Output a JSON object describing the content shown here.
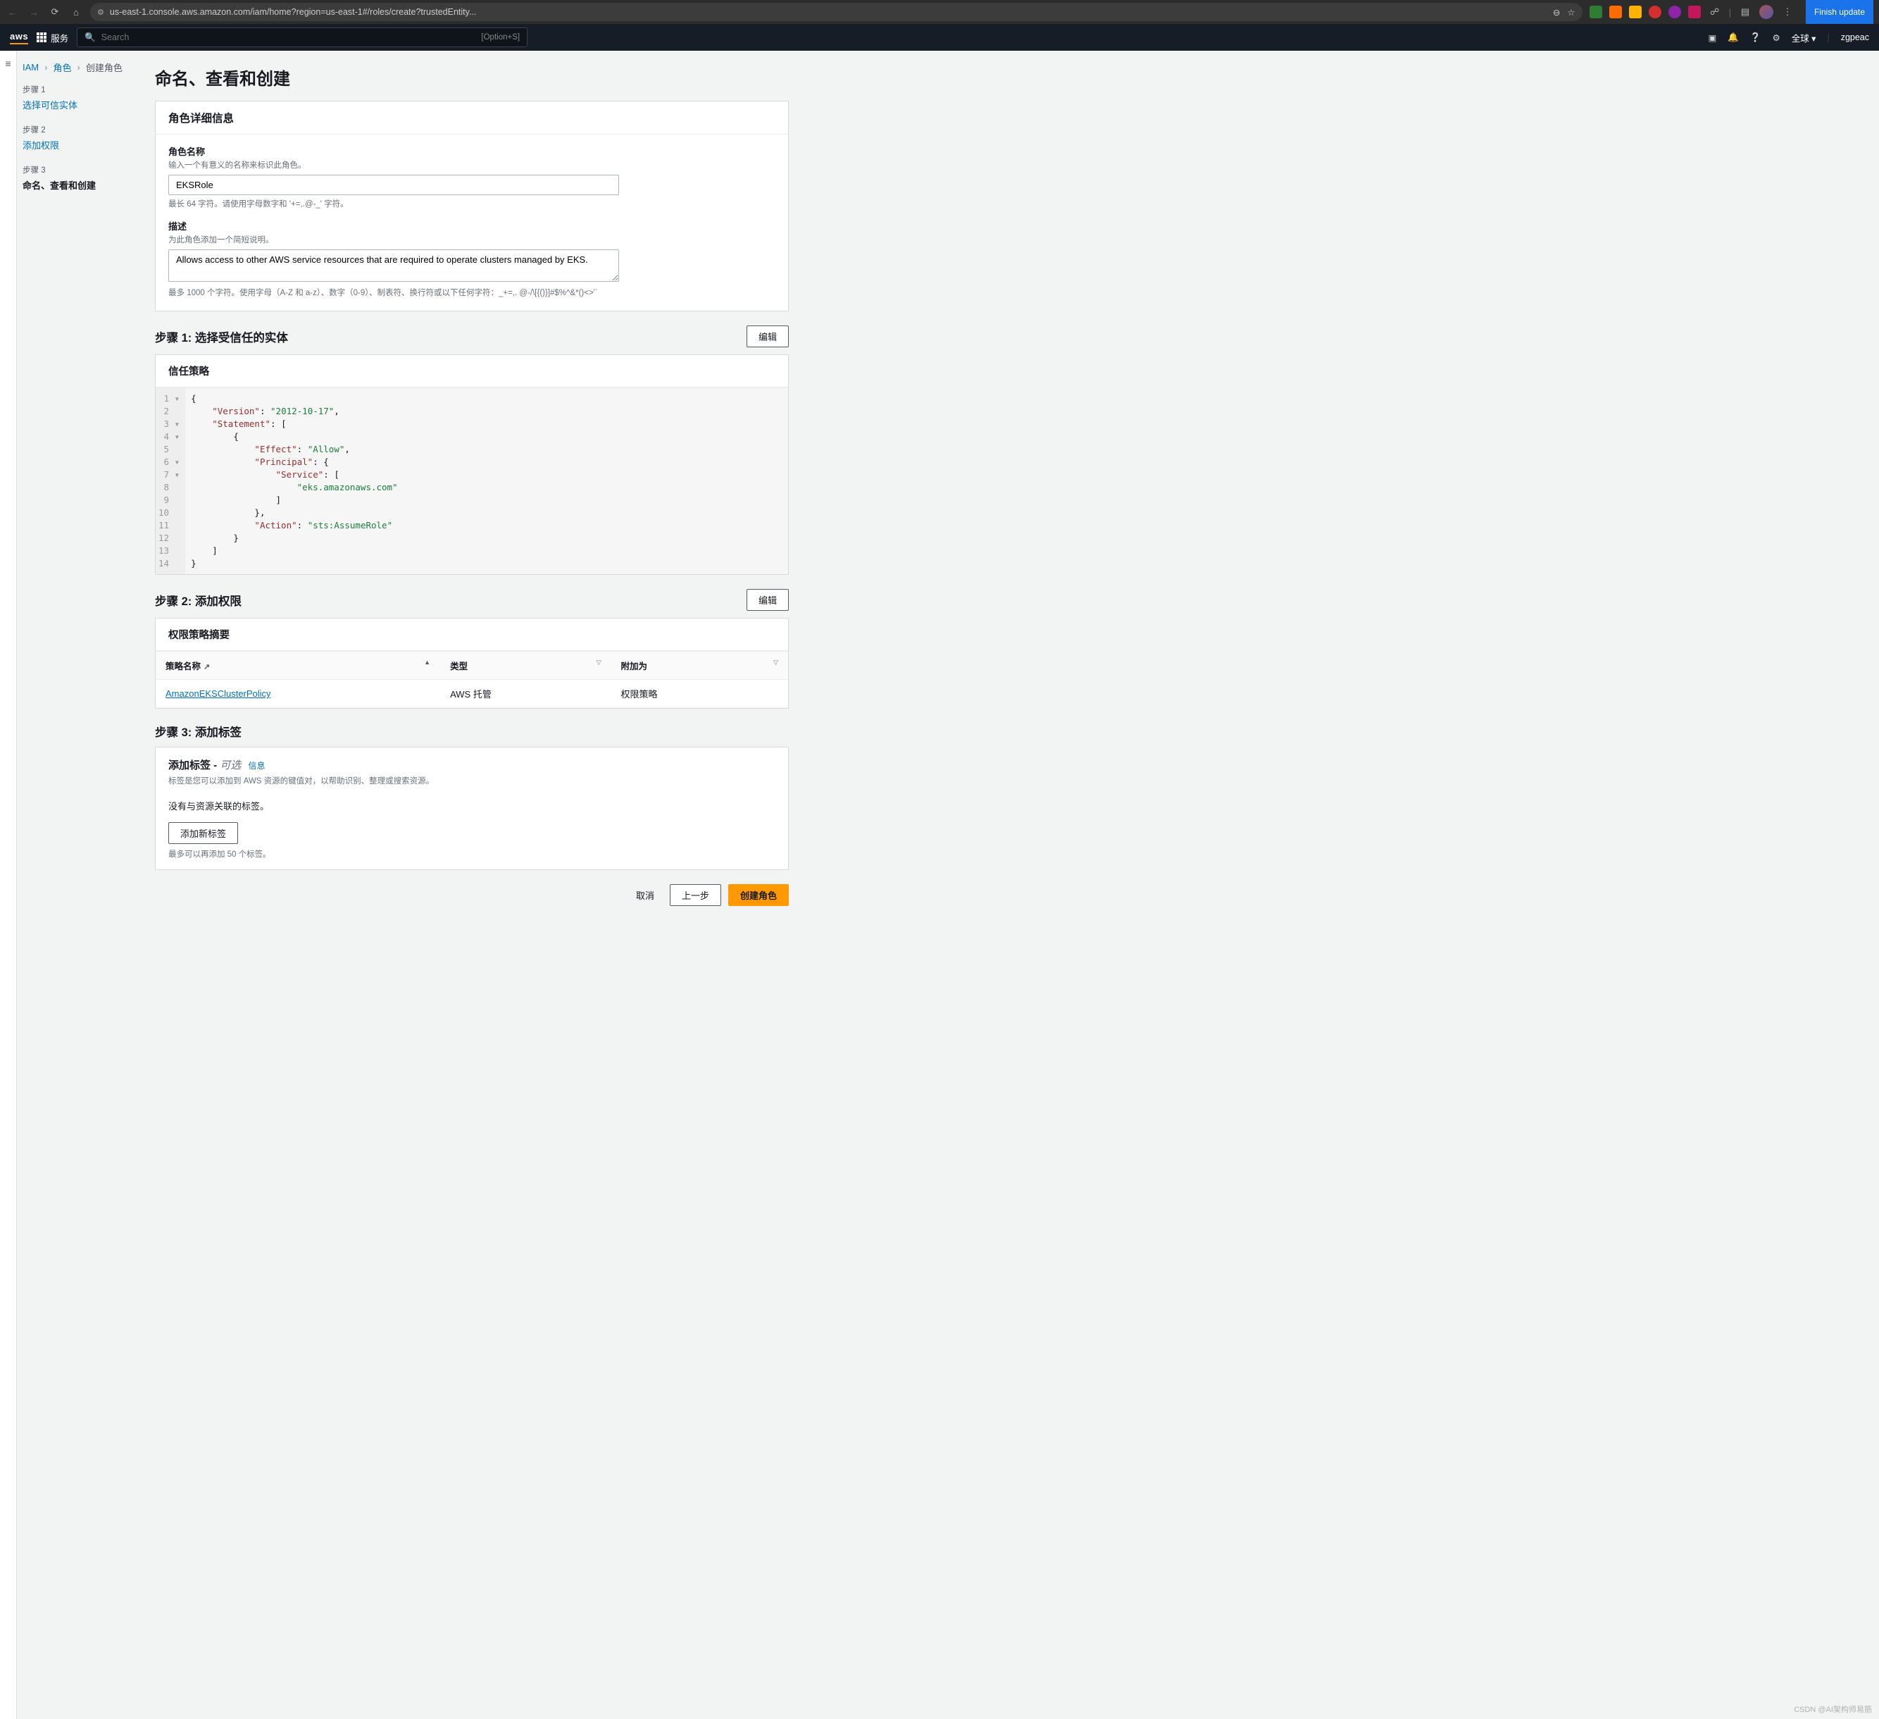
{
  "chrome": {
    "url": "us-east-1.console.aws.amazon.com/iam/home?region=us-east-1#/roles/create?trustedEntity...",
    "finish_update": "Finish update"
  },
  "aws_nav": {
    "services": "服务",
    "search_placeholder": "Search",
    "search_shortcut": "[Option+S]",
    "region": "全球 ▾",
    "user": "zgpeac"
  },
  "breadcrumb": {
    "iam": "IAM",
    "roles": "角色",
    "current": "创建角色"
  },
  "sidebar_steps": [
    {
      "label": "步骤 1",
      "title": "选择可信实体",
      "link": true,
      "active": false
    },
    {
      "label": "步骤 2",
      "title": "添加权限",
      "link": true,
      "active": false
    },
    {
      "label": "步骤 3",
      "title": "命名、查看和创建",
      "link": false,
      "active": true
    }
  ],
  "page_title": "命名、查看和创建",
  "details_panel": {
    "header": "角色详细信息",
    "role_name_label": "角色名称",
    "role_name_desc": "输入一个有意义的名称来标识此角色。",
    "role_name_value": "EKSRole",
    "role_name_help": "最长 64 字符。请使用字母数字和 '+=,.@-_' 字符。",
    "desc_label": "描述",
    "desc_desc": "为此角色添加一个简短说明。",
    "desc_value": "Allows access to other AWS service resources that are required to operate clusters managed by EKS.",
    "desc_help": "最多 1000 个字符。使用字母（A-Z 和 a-z）、数字（0-9）、制表符、换行符或以下任何字符：_+=,. @-/\\[{()}]#$%^&*()<>'`"
  },
  "step1": {
    "title": "步骤 1: 选择受信任的实体",
    "edit": "编辑",
    "trust_policy_header": "信任策略",
    "gutter": [
      "1 ▾",
      "2  ",
      "3 ▾",
      "4 ▾",
      "5  ",
      "6 ▾",
      "7 ▾",
      "8  ",
      "9  ",
      "10  ",
      "11  ",
      "12  ",
      "13  ",
      "14  "
    ],
    "policy": {
      "Version": "2012-10-17",
      "Statement": [
        {
          "Effect": "Allow",
          "Principal": {
            "Service": [
              "eks.amazonaws.com"
            ]
          },
          "Action": "sts:AssumeRole"
        }
      ]
    }
  },
  "step2": {
    "title": "步骤 2: 添加权限",
    "edit": "编辑",
    "summary_header": "权限策略摘要",
    "columns": {
      "name": "策略名称",
      "type": "类型",
      "attached": "附加为"
    },
    "rows": [
      {
        "name": "AmazonEKSClusterPolicy",
        "type": "AWS 托管",
        "attached": "权限策略"
      }
    ]
  },
  "step3": {
    "title": "步骤 3: 添加标签",
    "tags_header": "添加标签 -",
    "optional": "可选",
    "info": "信息",
    "tags_desc": "标签是您可以添加到 AWS 资源的键值对，以帮助识别、整理或搜索资源。",
    "no_tags": "没有与资源关联的标签。",
    "add_tag_btn": "添加新标签",
    "max_tags": "最多可以再添加 50 个标签。"
  },
  "footer": {
    "cancel": "取消",
    "prev": "上一步",
    "create": "创建角色"
  },
  "watermark": "CSDN @AI架构师易筋"
}
